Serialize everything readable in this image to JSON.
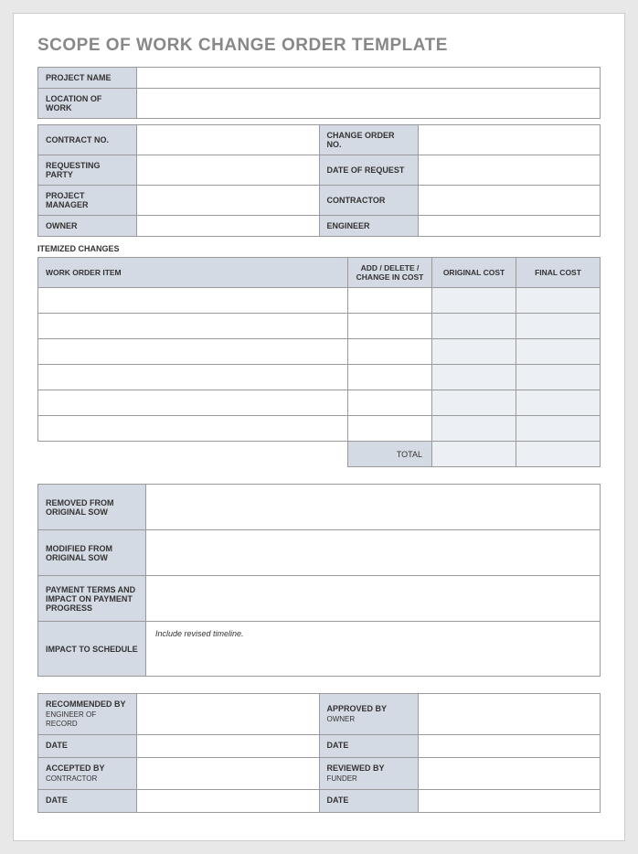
{
  "title": "SCOPE OF WORK CHANGE ORDER TEMPLATE",
  "header": {
    "project_name_label": "PROJECT NAME",
    "project_name_value": "",
    "location_label": "LOCATION OF WORK",
    "location_value": "",
    "contract_no_label": "CONTRACT NO.",
    "contract_no_value": "",
    "change_order_no_label": "CHANGE ORDER NO.",
    "change_order_no_value": "",
    "requesting_party_label": "REQUESTING PARTY",
    "requesting_party_value": "",
    "date_of_request_label": "DATE OF REQUEST",
    "date_of_request_value": "",
    "project_manager_label": "PROJECT MANAGER",
    "project_manager_value": "",
    "contractor_label": "CONTRACTOR",
    "contractor_value": "",
    "owner_label": "OWNER",
    "owner_value": "",
    "engineer_label": "ENGINEER",
    "engineer_value": ""
  },
  "itemized": {
    "heading": "ITEMIZED CHANGES",
    "columns": {
      "work_order_item": "WORK ORDER ITEM",
      "add_delete": "ADD / DELETE / CHANGE IN COST",
      "original_cost": "ORIGINAL COST",
      "final_cost": "FINAL COST"
    },
    "rows": [
      {
        "item": "",
        "change": "",
        "original": "",
        "final": ""
      },
      {
        "item": "",
        "change": "",
        "original": "",
        "final": ""
      },
      {
        "item": "",
        "change": "",
        "original": "",
        "final": ""
      },
      {
        "item": "",
        "change": "",
        "original": "",
        "final": ""
      },
      {
        "item": "",
        "change": "",
        "original": "",
        "final": ""
      },
      {
        "item": "",
        "change": "",
        "original": "",
        "final": ""
      }
    ],
    "total_label": "TOTAL",
    "total_original": "",
    "total_final": ""
  },
  "notes": {
    "removed_label": "REMOVED FROM ORIGINAL SOW",
    "removed_value": "",
    "modified_label": "MODIFIED FROM ORIGINAL SOW",
    "modified_value": "",
    "payment_label": "PAYMENT TERMS AND IMPACT ON PAYMENT PROGRESS",
    "payment_value": "",
    "schedule_label": "IMPACT TO SCHEDULE",
    "schedule_value": "Include revised timeline."
  },
  "signoff": {
    "recommended_label": "RECOMMENDED BY",
    "recommended_sub": "ENGINEER OF RECORD",
    "recommended_value": "",
    "approved_label": "APPROVED BY",
    "approved_sub": "OWNER",
    "approved_value": "",
    "date_label": "DATE",
    "recommended_date": "",
    "approved_date": "",
    "accepted_label": "ACCEPTED BY",
    "accepted_sub": "CONTRACTOR",
    "accepted_value": "",
    "reviewed_label": "REVIEWED BY",
    "reviewed_sub": "FUNDER",
    "reviewed_value": "",
    "accepted_date": "",
    "reviewed_date": ""
  }
}
